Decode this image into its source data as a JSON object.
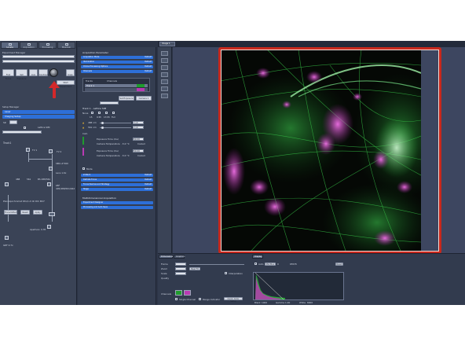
{
  "left_panel": {
    "tabs": [
      "Locate",
      "Acquisition",
      "Processing",
      "Maintain"
    ],
    "section_experiment": "Experiment Manager",
    "buttons": [
      "Find Focus",
      "Set Exposure",
      "Live",
      "Continuous",
      "Snap"
    ],
    "start_experiment": "Start Experiment",
    "smart_setup": "Setup Manager",
    "subsections": [
      "Laser",
      "Imaging Setup"
    ],
    "track_label": "Track1",
    "sr": "SR",
    "lattice": "Lattice SIM",
    "filters": [
      "TV 1",
      "TV 2"
    ],
    "lbf": "SBS LP 560",
    "lens": "Lens 1.6x",
    "objective": "Plan-Apochromat 63x/1.4 Oil DIC M27",
    "aperture": "Aperture: 0.35",
    "buttons_row": [
      "Transmitted",
      "Reset",
      "Apply"
    ],
    "zoom": "GRF 0.7x",
    "wavelengths": [
      "488",
      "561"
    ],
    "bs": "BS 488/561",
    "emission": "LBF 405/488/561/642"
  },
  "mid_panel": {
    "header": "Acquisition Parameter",
    "rows": [
      {
        "label": "Acquisition Mode",
        "status": "Default"
      },
      {
        "label": "Illumination",
        "status": "Default"
      },
      {
        "label": "Online Processing Options",
        "status": "Default"
      },
      {
        "label": "Channels",
        "status": "Default"
      }
    ],
    "track_table_headers": [
      "Tracks",
      "Channels"
    ],
    "track_name": "Track 1",
    "set_exposure": "Set Exposure",
    "camera": "Camera 1",
    "track_header": "Track 1 - Lattice SIM",
    "grating_options": [
      "None",
      "15",
      "9 Ph",
      "13 Ph",
      "Full"
    ],
    "laser_label": "488 nm",
    "laser_value": "1.0",
    "laser2_label": "561 nm",
    "laser2_value": "1.0",
    "cam_label": "Cam",
    "exposure_label": "Exposure Time (ms)",
    "exposure_value": "50.00",
    "exposure2_value": "50.00",
    "camera_temp_label": "Camera Temperature",
    "camera_temp_value": "-5.0 °C",
    "cooled": "Cooled",
    "mode": "Mode",
    "lower_rows": [
      {
        "label": "Z-Stack",
        "status": "Default"
      },
      {
        "label": "Definite Focus",
        "status": "Default"
      },
      {
        "label": "Focus Devices and Strategy",
        "status": "Default"
      },
      {
        "label": "Stage",
        "status": "Default"
      }
    ],
    "multi_header": "Multidimensional Acquisition",
    "multi_rows": [
      {
        "label": "Experiment Designer",
        "status": ""
      },
      {
        "label": "Processing and Auto Save",
        "status": ""
      }
    ]
  },
  "viewer": {
    "tab": "Image 1",
    "vtools": [
      "2D",
      "3D",
      "split",
      "gallery",
      "ortho",
      "profile",
      "info"
    ]
  },
  "bottom_panel": {
    "tabs": [
      "Dimensions",
      "Graphics",
      "Display"
    ],
    "labels": [
      "Frame",
      "Zoom",
      "Scale",
      "Quality",
      "Channels",
      "Range Indicator",
      "Single Channel",
      "Quick Color Setup",
      "Interpolation",
      "Best Fit",
      "Min/Max",
      "Black",
      "White",
      "Gamma",
      "Reset",
      "Auto"
    ],
    "values": {
      "min": "0",
      "max": "65535",
      "black": "1000",
      "white": "8000",
      "gamma": "1.00"
    }
  },
  "colors": {
    "accent": "#2d6fd8",
    "frame": "#c8281c",
    "bg": "#2c3446"
  }
}
